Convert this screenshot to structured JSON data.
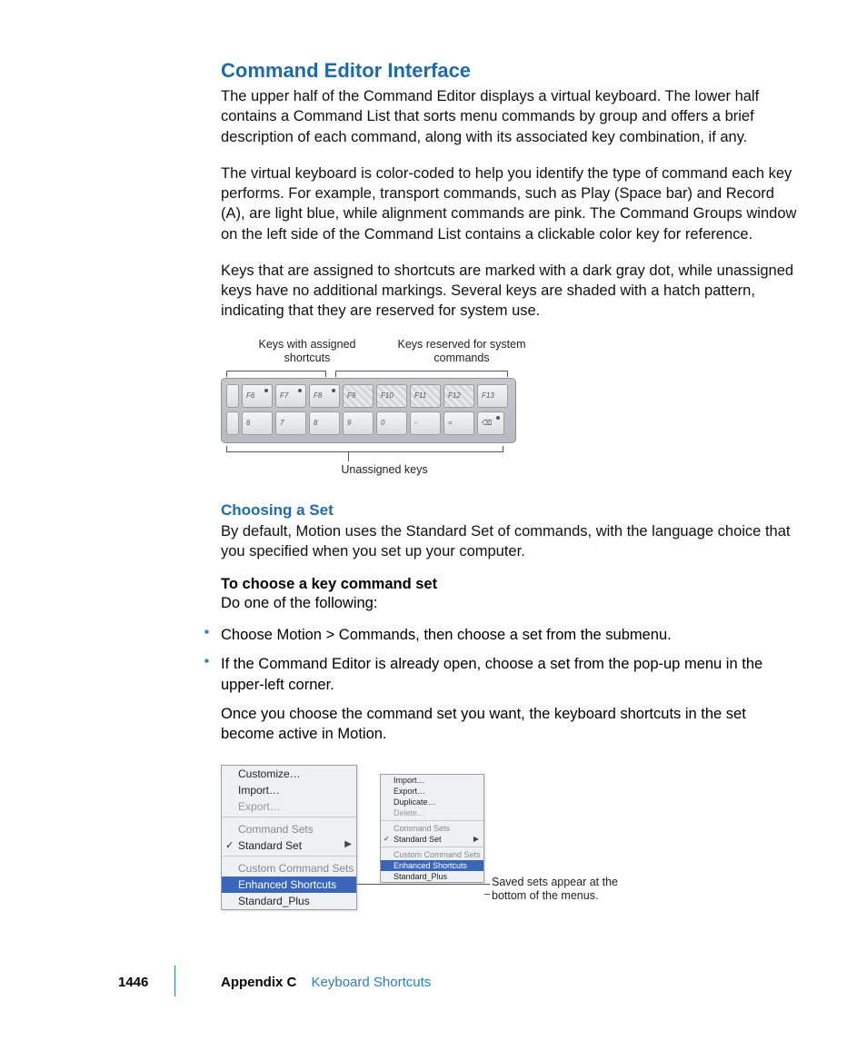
{
  "heading": "Command Editor Interface",
  "para1": "The upper half of the Command Editor displays a virtual keyboard. The lower half contains a Command List that sorts menu commands by group and offers a brief description of each command, along with its associated key combination, if any.",
  "para2": "The virtual keyboard is color-coded to help you identify the type of command each key performs. For example, transport commands, such as Play (Space bar) and Record (A), are light blue, while alignment commands are pink. The Command Groups window on the left side of the Command List contains a clickable color key for reference.",
  "para3": "Keys that are assigned to shortcuts are marked with a dark gray dot, while unassigned keys have no additional markings. Several keys are shaded with a hatch pattern, indicating that they are reserved for system use.",
  "kbd": {
    "anno_left": "Keys with assigned shortcuts",
    "anno_right": "Keys reserved for system commands",
    "anno_bottom": "Unassigned keys",
    "row1": [
      "F6",
      "F7",
      "F8",
      "F9",
      "F10",
      "F11",
      "F12",
      "F13"
    ],
    "row2": [
      "6",
      "7",
      "8",
      "9",
      "0",
      "-",
      "=",
      "⌫"
    ]
  },
  "subhead": "Choosing a Set",
  "para4": "By default, Motion uses the Standard Set of commands, with the language choice that you specified when you set up your computer.",
  "task_lead": "To choose a key command set",
  "task_intro": "Do one of the following:",
  "bullets": [
    "Choose Motion > Commands, then choose a set from the submenu.",
    "If the Command Editor is already open, choose a set from the pop-up menu in the upper-left corner."
  ],
  "after_list": "Once you choose the command set you want, the keyboard shortcuts in the set become active in Motion.",
  "menu_big": {
    "customize": "Customize…",
    "import": "Import…",
    "export": "Export…",
    "header1": "Command Sets",
    "standard": "Standard Set",
    "header2": "Custom Command Sets",
    "enhanced": "Enhanced Shortcuts",
    "plus": "Standard_Plus"
  },
  "menu_small": {
    "import": "Import…",
    "export": "Export…",
    "duplicate": "Duplicate…",
    "delete": "Delete…",
    "header1": "Command Sets",
    "standard": "Standard Set",
    "header2": "Custom Command Sets",
    "enhanced": "Enhanced Shortcuts",
    "plus": "Standard_Plus"
  },
  "menu_caption": "Saved sets appear at the bottom of the menus.",
  "footer": {
    "page": "1446",
    "appendix": "Appendix C",
    "title": "Keyboard Shortcuts"
  }
}
